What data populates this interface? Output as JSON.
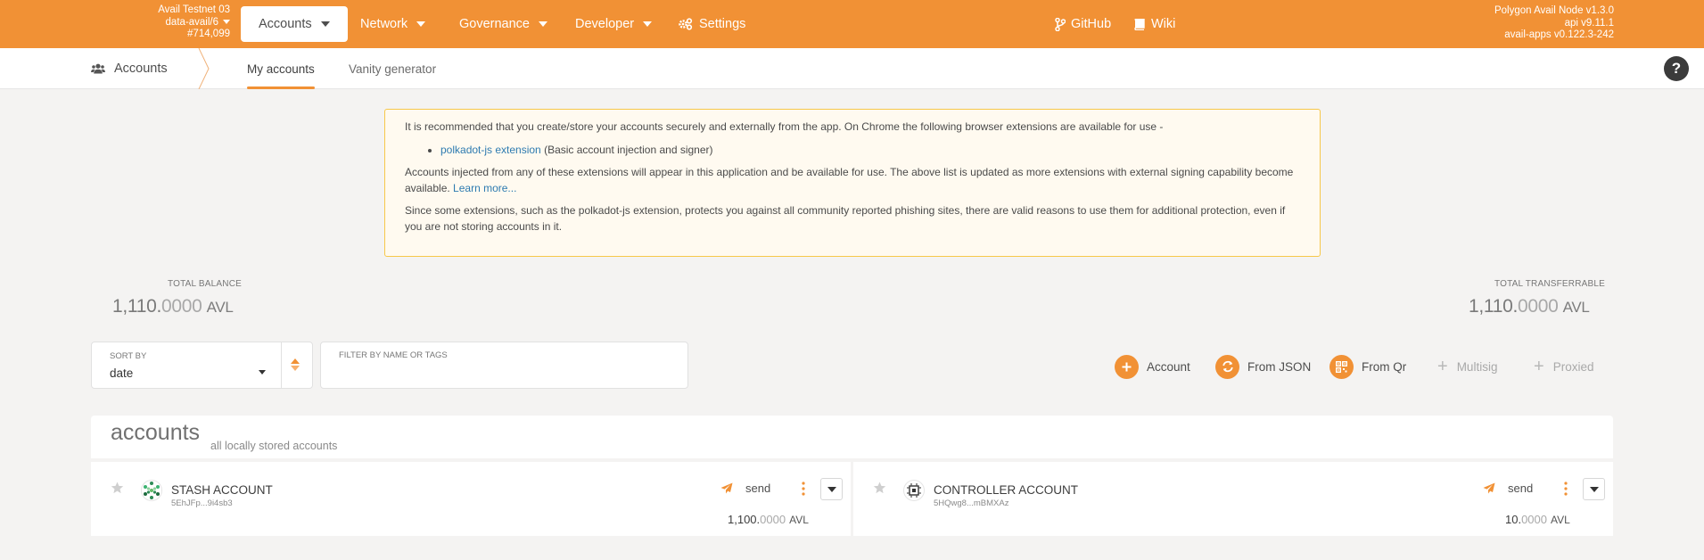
{
  "chain": {
    "name": "Avail Testnet 03",
    "spec": "data-avail/6",
    "block": "#714,099"
  },
  "menu": {
    "accounts": "Accounts",
    "network": "Network",
    "governance": "Governance",
    "developer": "Developer",
    "settings": "Settings",
    "github": "GitHub",
    "wiki": "Wiki"
  },
  "node": {
    "name": "Polygon Avail Node v1.3.0",
    "api": "api v9.11.1",
    "apps": "avail-apps v0.122.3-242"
  },
  "subnav": {
    "section": "Accounts",
    "tabs": [
      "My accounts",
      "Vanity generator"
    ],
    "help": "?"
  },
  "notice": {
    "line1": "It is recommended that you create/store your accounts securely and externally from the app. On Chrome the following browser extensions are available for use -",
    "ext_link": "polkadot-js extension",
    "ext_desc": "(Basic account injection and signer)",
    "line2": "Accounts injected from any of these extensions will appear in this application and be available for use. The above list is updated as more extensions with external signing capability become available.",
    "learn_more": "Learn more...",
    "line3": "Since some extensions, such as the polkadot-js extension, protects you against all community reported phishing sites, there are valid reasons to use them for additional protection, even if you are not storing accounts in it."
  },
  "totals": {
    "balance_label": "TOTAL BALANCE",
    "balance_int": "1,110.",
    "balance_dec": "0000",
    "balance_unit": "AVL",
    "transferrable_label": "TOTAL TRANSFERRABLE",
    "transferrable_int": "1,110.",
    "transferrable_dec": "0000",
    "transferrable_unit": "AVL"
  },
  "sort": {
    "label": "SORT BY",
    "value": "date"
  },
  "filter": {
    "label": "FILTER BY NAME OR TAGS",
    "value": ""
  },
  "actions": {
    "account": "Account",
    "from_json": "From JSON",
    "from_qr": "From Qr",
    "multisig": "Multisig",
    "proxied": "Proxied"
  },
  "accounts_header": {
    "title": "accounts",
    "subtitle": "all locally stored accounts"
  },
  "accounts": [
    {
      "name": "STASH ACCOUNT",
      "address": "5EhJFp...9i4sb3",
      "send": "send",
      "balance_int": "1,100.",
      "balance_dec": "0000",
      "unit": "AVL"
    },
    {
      "name": "CONTROLLER ACCOUNT",
      "address": "5HQwg8...mBMXAz",
      "send": "send",
      "balance_int": "10.",
      "balance_dec": "0000",
      "unit": "AVL"
    }
  ],
  "colors": {
    "accent": "#f19135",
    "notice_border": "#f7c84a"
  }
}
